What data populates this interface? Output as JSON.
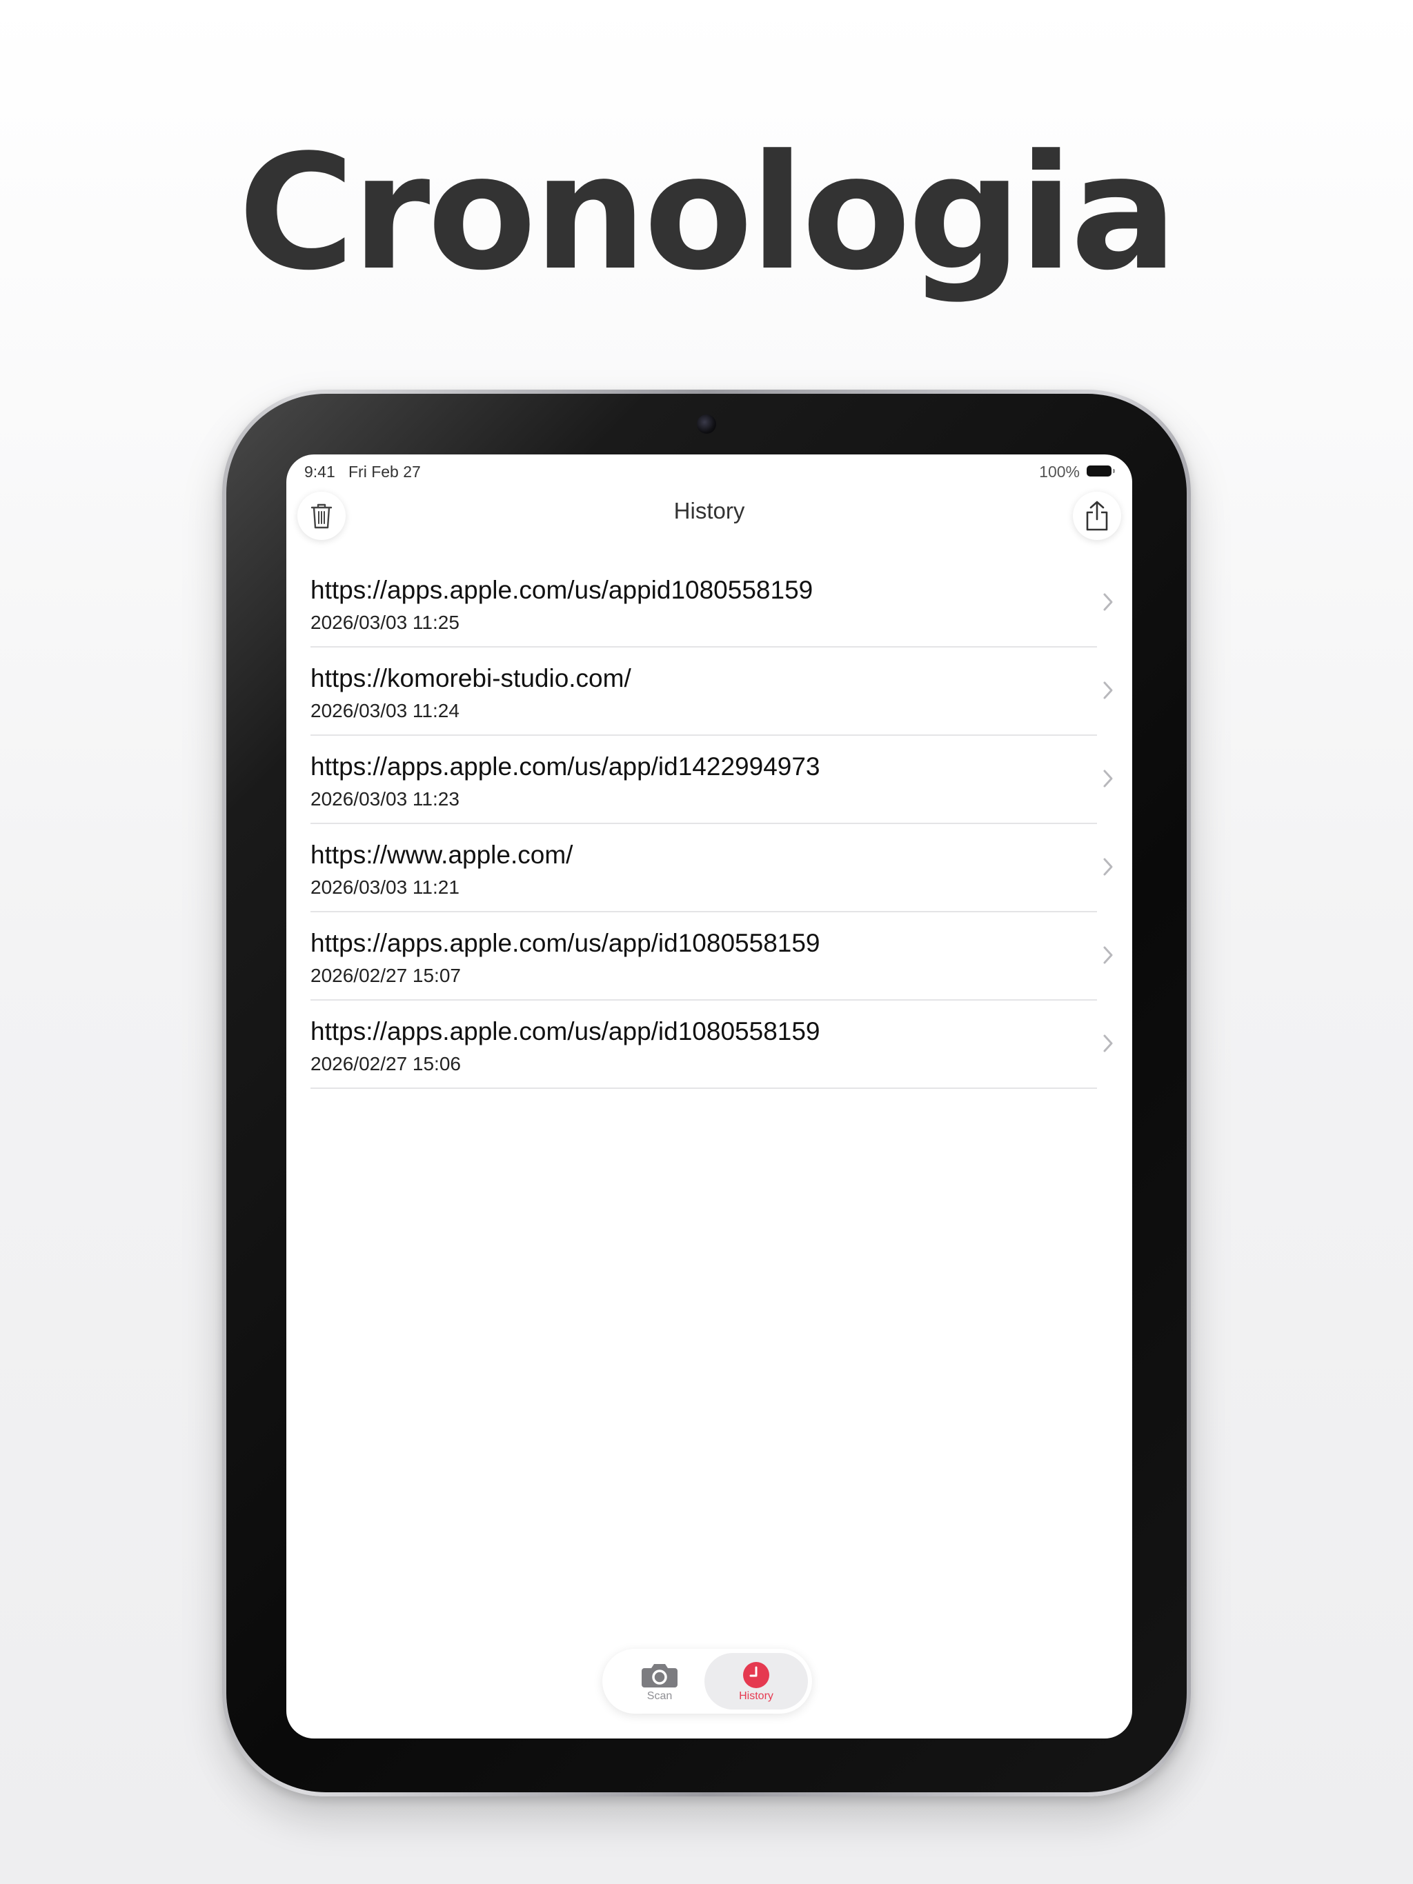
{
  "headline": "Cronologia",
  "status_bar": {
    "time": "9:41",
    "date": "Fri Feb 27",
    "battery": "100%"
  },
  "nav": {
    "title": "History",
    "left_icon": "trash-icon",
    "right_icon": "share-icon"
  },
  "history": [
    {
      "url": "https://apps.apple.com/us/appid1080558159",
      "date": "2026/03/03 11:25"
    },
    {
      "url": "https://komorebi-studio.com/",
      "date": "2026/03/03 11:24"
    },
    {
      "url": "https://apps.apple.com/us/app/id1422994973",
      "date": "2026/03/03 11:23"
    },
    {
      "url": "https://www.apple.com/",
      "date": "2026/03/03 11:21"
    },
    {
      "url": "https://apps.apple.com/us/app/id1080558159",
      "date": "2026/02/27 15:07"
    },
    {
      "url": "https://apps.apple.com/us/app/id1080558159",
      "date": "2026/02/27 15:06"
    }
  ],
  "tabs": [
    {
      "label": "Scan",
      "icon": "camera-icon",
      "selected": false
    },
    {
      "label": "History",
      "icon": "clock-icon",
      "selected": true
    }
  ],
  "colors": {
    "accent": "#e53950",
    "headline": "#333333",
    "bezel": "#0a0a0a"
  }
}
